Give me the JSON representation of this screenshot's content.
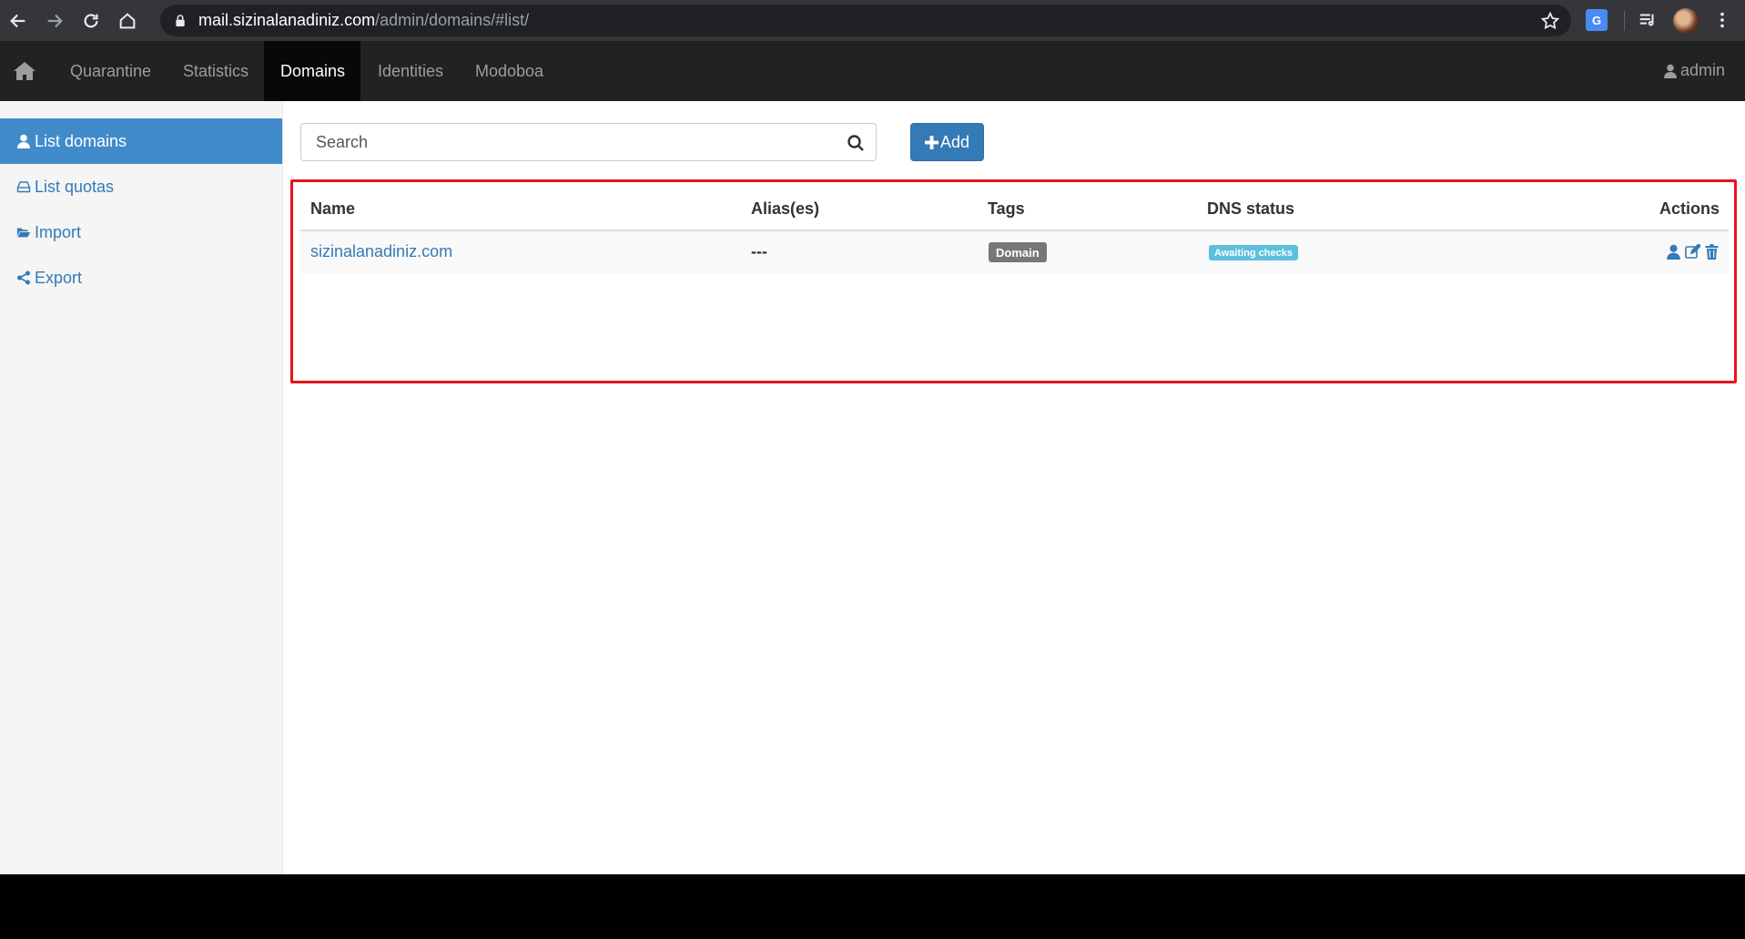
{
  "browser": {
    "url_host": "mail.sizinalanadiniz.com",
    "url_path": "/admin/domains/#list/"
  },
  "navbar": {
    "items": [
      {
        "label": "Quarantine"
      },
      {
        "label": "Statistics"
      },
      {
        "label": "Domains",
        "active": true
      },
      {
        "label": "Identities"
      },
      {
        "label": "Modoboa"
      }
    ],
    "user": "admin"
  },
  "sidebar": {
    "items": [
      {
        "label": "List domains",
        "icon": "user-icon",
        "active": true
      },
      {
        "label": "List quotas",
        "icon": "hdd-icon"
      },
      {
        "label": "Import",
        "icon": "folder-open-icon"
      },
      {
        "label": "Export",
        "icon": "share-icon"
      }
    ]
  },
  "search": {
    "placeholder": "Search"
  },
  "toolbar": {
    "add_label": "Add"
  },
  "table": {
    "headers": [
      "Name",
      "Alias(es)",
      "Tags",
      "DNS status",
      "Actions"
    ],
    "rows": [
      {
        "name": "sizinalanadiniz.com",
        "aliases": "---",
        "tag": "Domain",
        "dns_status": "Awaiting checks",
        "actions": [
          "user-icon",
          "edit-icon",
          "trash-icon"
        ]
      }
    ]
  },
  "colors": {
    "primary": "#337ab7",
    "active_sidebar": "#428bca",
    "highlight": "#e8121c",
    "tag_domain": "#777777",
    "tag_dns": "#5bc0de"
  }
}
